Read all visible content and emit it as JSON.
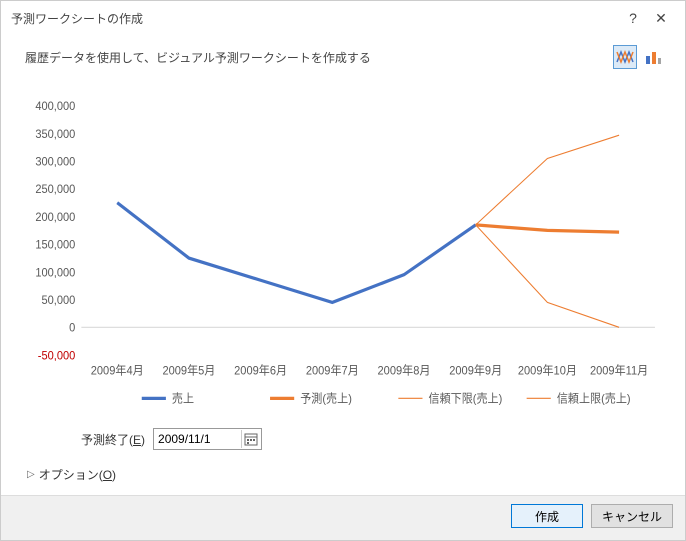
{
  "titlebar": {
    "title": "予測ワークシートの作成",
    "help_label": "?",
    "close_label": "✕"
  },
  "subtitle": "履歴データを使用して、ビジュアル予測ワークシートを作成する",
  "chart_data": {
    "type": "line",
    "title": "",
    "xlabel": "",
    "ylabel": "",
    "ylim": [
      -50000,
      400000
    ],
    "categories": [
      "2009年4月",
      "2009年5月",
      "2009年6月",
      "2009年7月",
      "2009年8月",
      "2009年9月",
      "2009年10月",
      "2009年11月"
    ],
    "y_ticks": [
      -50000,
      0,
      50000,
      100000,
      150000,
      200000,
      250000,
      300000,
      350000,
      400000
    ],
    "y_tick_labels": [
      "-50,000",
      "0",
      "50,000",
      "100,000",
      "150,000",
      "200,000",
      "250,000",
      "300,000",
      "350,000",
      "400,000"
    ],
    "series": [
      {
        "name": "売上",
        "color": "#4472c4",
        "width": 3,
        "values": [
          225000,
          125000,
          85000,
          45000,
          95000,
          185000,
          null,
          null
        ]
      },
      {
        "name": "予測(売上)",
        "color": "#ed7d31",
        "width": 3,
        "values": [
          null,
          null,
          null,
          null,
          null,
          185000,
          175000,
          172000
        ]
      },
      {
        "name": "信頼下限(売上)",
        "color": "#ed7d31",
        "width": 1,
        "values": [
          null,
          null,
          null,
          null,
          null,
          185000,
          45000,
          0
        ]
      },
      {
        "name": "信頼上限(売上)",
        "color": "#ed7d31",
        "width": 1,
        "values": [
          null,
          null,
          null,
          null,
          null,
          185000,
          305000,
          347000
        ]
      }
    ]
  },
  "form": {
    "forecast_end_label": "予測終了(E)",
    "forecast_end_hotkey": "E",
    "forecast_end_value": "2009/11/1"
  },
  "options": {
    "label": "オプション(O)",
    "hotkey": "O"
  },
  "buttons": {
    "create": "作成",
    "cancel": "キャンセル"
  }
}
